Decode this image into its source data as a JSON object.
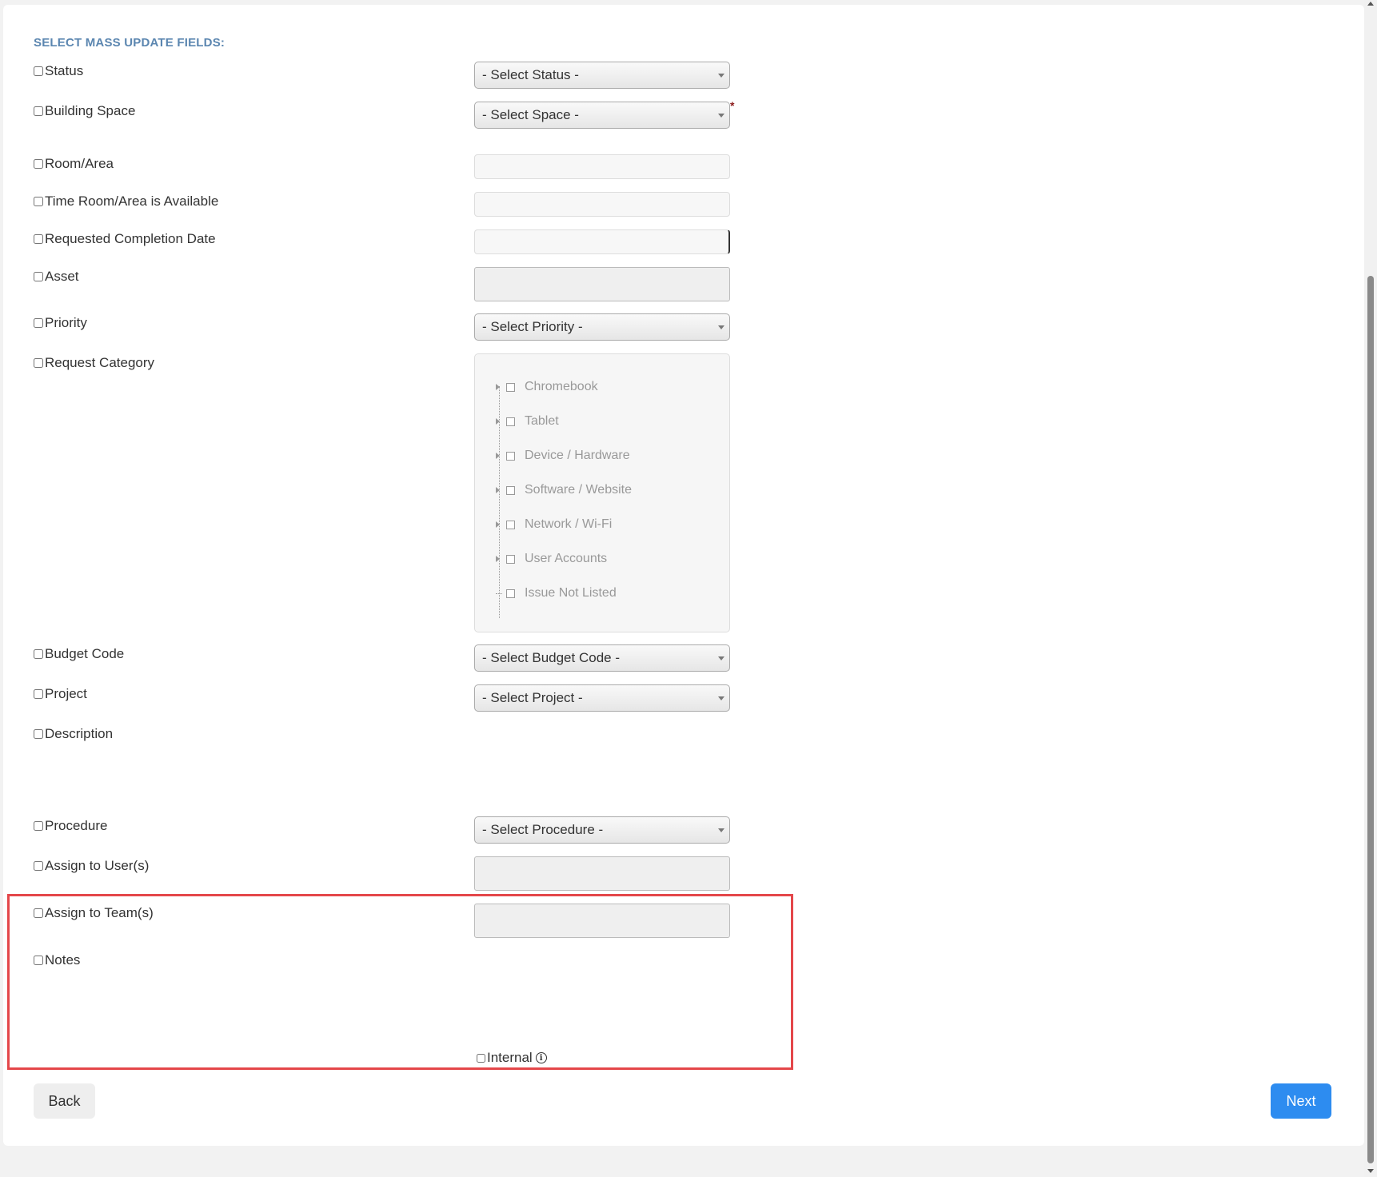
{
  "form": {
    "section_title": "SELECT MASS UPDATE FIELDS:",
    "fields": {
      "status": {
        "label": "Status",
        "placeholder": "- Select Status -"
      },
      "building_space": {
        "label": "Building Space",
        "placeholder": "- Select Space -",
        "required_mark": "*"
      },
      "room_area": {
        "label": "Room/Area"
      },
      "time_available": {
        "label": "Time Room/Area is Available"
      },
      "requested_completion_date": {
        "label": "Requested Completion Date"
      },
      "asset": {
        "label": "Asset"
      },
      "priority": {
        "label": "Priority",
        "placeholder": "- Select Priority -"
      },
      "request_category": {
        "label": "Request Category",
        "items": [
          "Chromebook",
          "Tablet",
          "Device / Hardware",
          "Software / Website",
          "Network / Wi-Fi",
          "User Accounts",
          "Issue Not Listed"
        ]
      },
      "budget_code": {
        "label": "Budget Code",
        "placeholder": "- Select Budget Code -"
      },
      "project": {
        "label": "Project",
        "placeholder": "- Select Project -"
      },
      "description": {
        "label": "Description"
      },
      "procedure": {
        "label": "Procedure",
        "placeholder": "- Select Procedure -"
      },
      "assign_users": {
        "label": "Assign to User(s)"
      },
      "assign_teams": {
        "label": "Assign to Team(s)"
      },
      "notes": {
        "label": "Notes",
        "internal_label": "Internal",
        "info_icon": "info-icon"
      }
    }
  },
  "buttons": {
    "back": "Back",
    "next": "Next"
  },
  "colors": {
    "accent": "#2d8cf0",
    "section_title": "#5b86b0",
    "highlight": "#e4474a",
    "required": "#8b1a1a"
  }
}
